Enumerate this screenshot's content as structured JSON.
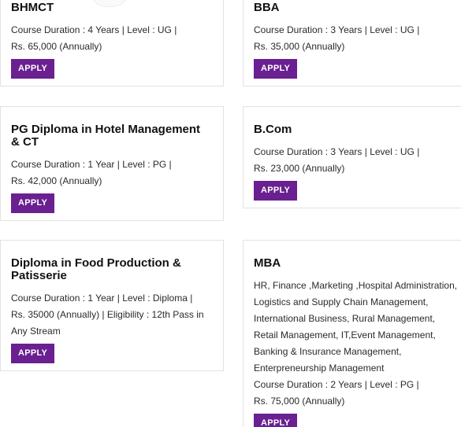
{
  "courses": [
    {
      "title": "BHMCT",
      "line1": "Course Duration : 4 Years | Level : UG |",
      "line2": "Rs. 65,000 (Annually)",
      "apply": "APPLY"
    },
    {
      "title": "BBA",
      "line1": "Course Duration : 3 Years | Level : UG |",
      "line2": "Rs. 35,000 (Annually)",
      "apply": "APPLY"
    },
    {
      "title": "PG Diploma in Hotel Management & CT",
      "line1": "Course Duration : 1 Year | Level : PG |",
      "line2": "Rs. 42,000 (Annually)",
      "apply": "APPLY"
    },
    {
      "title": "B.Com",
      "line1": "Course Duration : 3 Years | Level : UG |",
      "line2": "Rs. 23,000 (Annually)",
      "apply": "APPLY"
    },
    {
      "title": "Diploma in Food Production & Patisserie",
      "line1": "Course Duration : 1 Year | Level : Diploma |",
      "line2": "Rs. 35000 (Annually) | Eligibility : 12th Pass in Any Stream",
      "apply": "APPLY"
    },
    {
      "title": "MBA",
      "specializations": "HR, Finance ,Marketing ,Hospital Administration, Logistics and Supply Chain Management, International Business, Rural Management, Retail Management, IT,Event Management, Banking & Insurance Management, Enterpreneurship Management",
      "line1": "Course Duration : 2 Years | Level : PG |",
      "line2": "Rs. 75,000 (Annually)",
      "apply": "APPLY"
    }
  ],
  "theme": {
    "button_color": "#6a2090",
    "border_color": "#e2e2e2"
  }
}
